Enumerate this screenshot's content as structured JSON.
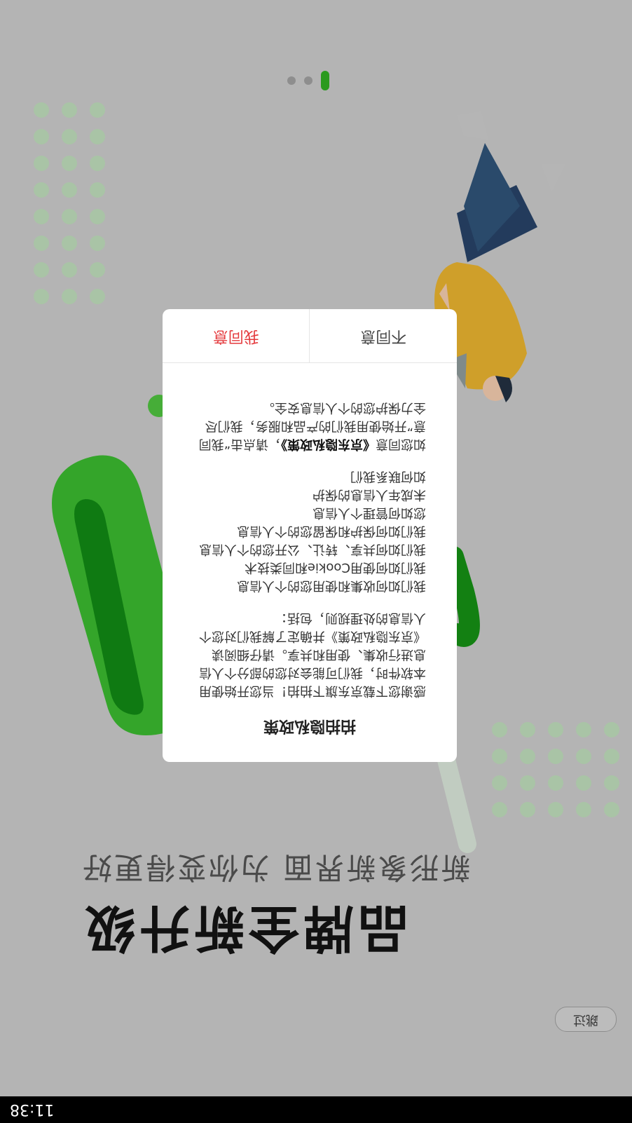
{
  "status_bar": {
    "time": "11:38"
  },
  "splash": {
    "skip_label": "跳过",
    "headline": "品牌全新升级",
    "subline": "新形象新界面 为你变得更好",
    "page_indicator": {
      "total": 3,
      "active_index": 0
    }
  },
  "privacy_dialog": {
    "title": "拍拍隐私政策",
    "intro": "感谢您下载京东旗下拍拍！当您开始使用本软件时，我们可能会对您的部分个人信息进行收集、使用和共享。请仔细阅读《京东隐私政策》并确定了解我们对您个人信息的处理规则，包括：",
    "items": [
      "我们如何收集和使用您的个人信息",
      "我们如何使用Cookie和同类技术",
      "我们如何共享、转让、公开您的个人信息",
      "我们如何保护和保留您的个人信息",
      "您如何管理个人信息",
      "未成年人信息的保护",
      "如何联系我们"
    ],
    "tail_before": "如您同意",
    "policy_link": "《京东隐私政策》",
    "tail_after": "，请点击“我同意”开始使用我们的产品和服务，我们尽全力保护您的个人信息安全。",
    "disagree_label": "不同意",
    "agree_label": "我同意"
  },
  "colors": {
    "brand_green": "#2a9a1e",
    "agree_red": "#e4393c",
    "overlay_gray": "#b4b4b4"
  },
  "icons": [
    "illustration-person",
    "illustration-green-loop",
    "illustration-phone-outline"
  ]
}
